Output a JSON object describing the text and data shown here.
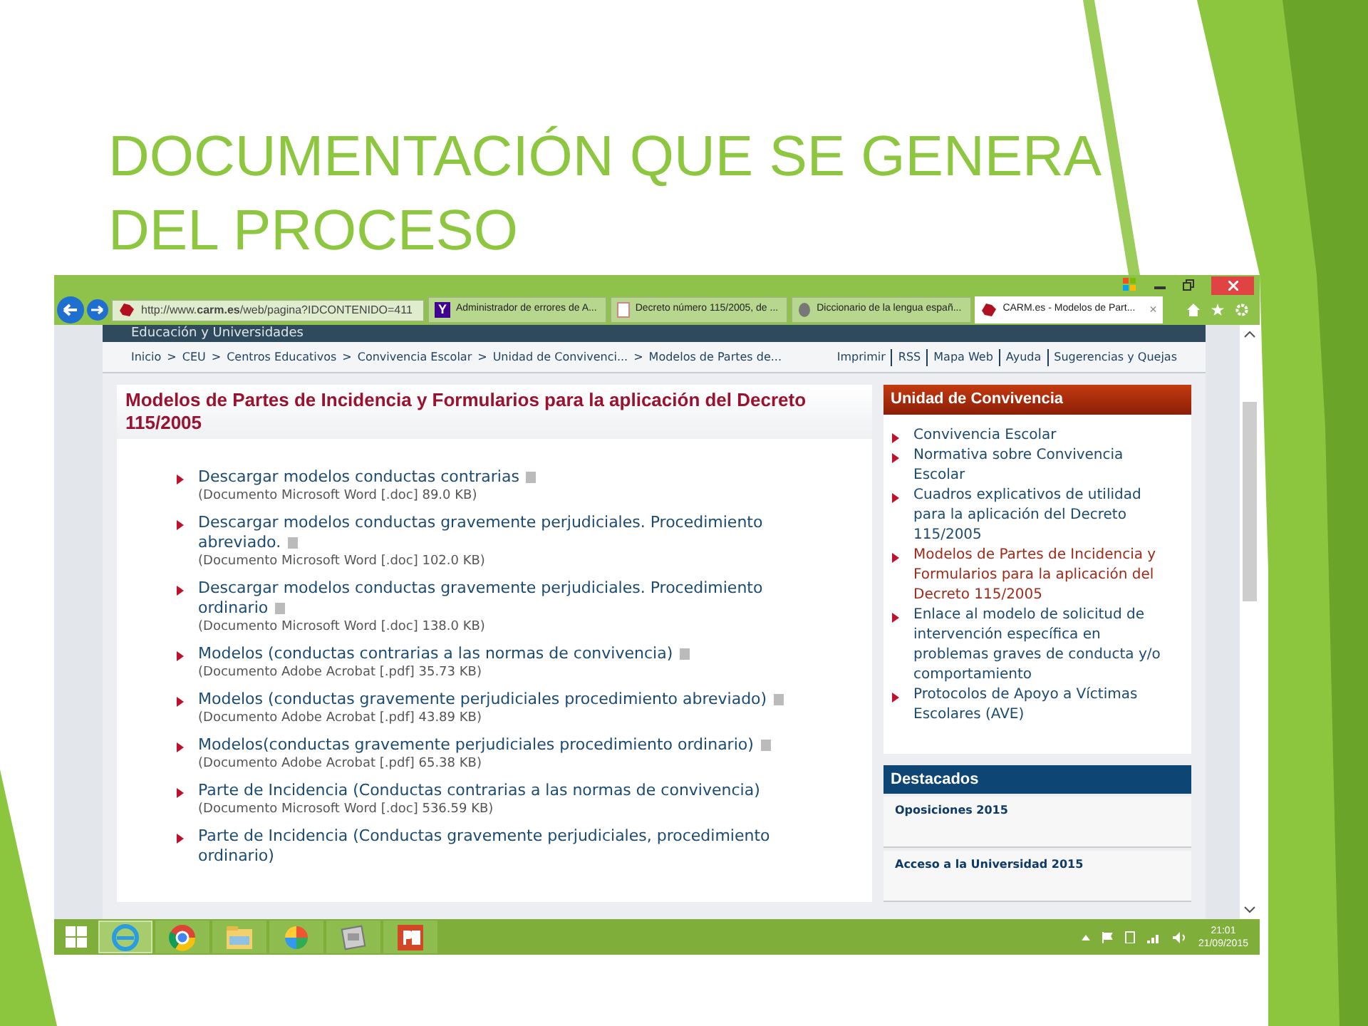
{
  "slide": {
    "title": "DOCUMENTACIÓN QUE SE GENERA DEL PROCESO"
  },
  "browser": {
    "address": "http://www.**carm.es**/web/pagina?IDCONTENIDO=411",
    "tabs": [
      {
        "label": "Administrador de errores de A...",
        "selected": false,
        "kind": "yahoo",
        "logo": "Y"
      },
      {
        "label": "Decreto número 115/2005, de ...",
        "selected": false,
        "kind": "doc"
      },
      {
        "label": "Diccionario de la lengua españ...",
        "selected": false,
        "kind": "rae"
      },
      {
        "label": "CARM.es - Modelos de Part...",
        "selected": true,
        "kind": "carm"
      }
    ],
    "close_tab": "×"
  },
  "page": {
    "header": "Educación y Universidades",
    "breadcrumb": [
      "Inicio",
      "CEU",
      "Centros Educativos",
      "Convivencia Escolar",
      "Unidad de Convivenci...",
      "Modelos de Partes de..."
    ],
    "breadcrumb_separator": ">",
    "utility_links": [
      "Imprimir",
      "RSS",
      "Mapa Web",
      "Ayuda",
      "Sugerencias y Quejas"
    ],
    "title": "Modelos de Partes de Incidencia y Formularios para la aplicación del Decreto 115/2005",
    "documents": [
      {
        "title": "Descargar modelos conductas contrarias",
        "info": "(Documento Microsoft Word [.doc] 89.0 KB)",
        "file_icon": true
      },
      {
        "title": "Descargar modelos conductas gravemente perjudiciales. Procedimiento abreviado.",
        "info": "(Documento Microsoft Word [.doc] 102.0 KB)",
        "file_icon": true
      },
      {
        "title": "Descargar modelos conductas gravemente perjudiciales. Procedimiento ordinario",
        "info": "(Documento Microsoft Word [.doc] 138.0 KB)",
        "file_icon": true
      },
      {
        "title": "Modelos (conductas contrarias a las normas de convivencia)",
        "info": "(Documento Adobe Acrobat [.pdf] 35.73 KB)",
        "file_icon": true
      },
      {
        "title": "Modelos (conductas gravemente perjudiciales procedimiento abreviado)",
        "info": "(Documento Adobe Acrobat [.pdf] 43.89 KB)",
        "file_icon": true
      },
      {
        "title": "Modelos(conductas gravemente perjudiciales procedimiento ordinario)",
        "info": "(Documento Adobe Acrobat [.pdf] 65.38 KB)",
        "file_icon": true
      },
      {
        "title": "Parte de Incidencia (Conductas contrarias a las normas de convivencia)",
        "info": "(Documento Microsoft Word [.doc] 536.59 KB)",
        "file_icon": false
      },
      {
        "title": "Parte de Incidencia (Conductas gravemente perjudiciales, procedimiento ordinario)",
        "file_icon": false
      }
    ],
    "sidebar": {
      "title": "Unidad de Convivencia",
      "items": [
        {
          "label": "Convivencia Escolar",
          "selected": false
        },
        {
          "label": "Normativa sobre Convivencia Escolar",
          "selected": false
        },
        {
          "label": "Cuadros explicativos de utilidad para la aplicación del Decreto 115/2005",
          "selected": false
        },
        {
          "label": "Modelos de Partes de Incidencia y Formularios para la aplicación del Decreto 115/2005",
          "selected": true
        },
        {
          "label": "Enlace al modelo de solicitud de intervención específica en problemas graves de conducta y/o comportamiento",
          "selected": false
        },
        {
          "label": "Protocolos de Apoyo a Víctimas Escolares (AVE)",
          "selected": false
        }
      ]
    },
    "featured": {
      "title": "Destacados",
      "items": [
        "Oposiciones 2015",
        "Acceso a la Universidad 2015"
      ]
    }
  },
  "taskbar": {
    "apps": [
      {
        "kind": "ie",
        "selected": true
      },
      {
        "kind": "chrome",
        "selected": false
      },
      {
        "kind": "explorer",
        "selected": false
      },
      {
        "kind": "picasa",
        "selected": false
      },
      {
        "kind": "tool",
        "selected": false
      },
      {
        "kind": "powerpoint",
        "selected": false
      }
    ],
    "time": "21:01",
    "date": "21/09/2015"
  }
}
